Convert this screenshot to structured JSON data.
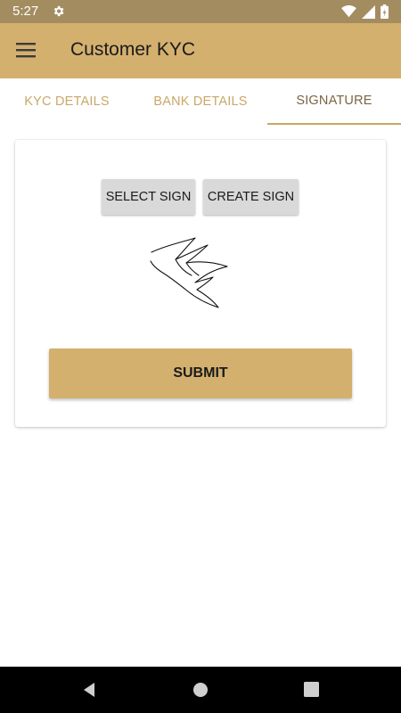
{
  "status_bar": {
    "time": "5:27",
    "icons": [
      "gear-icon",
      "wifi-icon",
      "signal-icon",
      "battery-icon"
    ]
  },
  "app_bar": {
    "title": "Customer KYC",
    "menu_icon": "hamburger-menu-icon"
  },
  "tabs": [
    {
      "label": "KYC DETAILS",
      "active": false
    },
    {
      "label": "BANK DETAILS",
      "active": false
    },
    {
      "label": "SIGNATURE",
      "active": true
    }
  ],
  "signature_card": {
    "select_sign_label": "SELECT SIGN",
    "create_sign_label": "CREATE SIGN",
    "submit_label": "SUBMIT"
  },
  "nav_bar": {
    "icons": [
      "back-icon",
      "home-icon",
      "recents-icon"
    ]
  },
  "colors": {
    "status_bar": "#a38c60",
    "app_bar": "#d4b06f",
    "tab_text": "#c9a769",
    "tab_active_text": "#7a6543",
    "button_grey": "#d9d9d9",
    "submit_button": "#d4b06f"
  }
}
